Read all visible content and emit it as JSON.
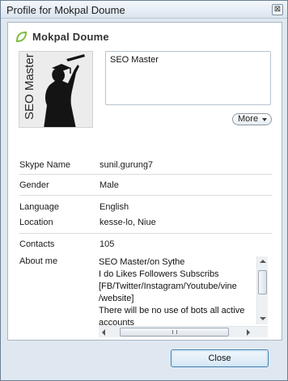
{
  "window": {
    "title": "Profile for Mokpal Doume",
    "close_glyph": "⊠"
  },
  "profile": {
    "name": "Mokpal Doume",
    "status_icon": "online-leaf-icon",
    "status_color": "#7cbc3b",
    "avatar_text": "SEO Master",
    "mood": "SEO Master",
    "more_label": "More"
  },
  "details": {
    "skype_name": {
      "label": "Skype Name",
      "value": "sunil.gurung7"
    },
    "gender": {
      "label": "Gender",
      "value": "Male"
    },
    "language": {
      "label": "Language",
      "value": "English"
    },
    "location": {
      "label": "Location",
      "value": "kesse-lo, Niue"
    },
    "contacts": {
      "label": "Contacts",
      "value": "105"
    },
    "about": {
      "label": "About me",
      "lines": [
        "SEO Master/on Sythe",
        "I do Likes Followers Subscribs",
        "[FB/Twitter/Instagram/Youtube/vine",
        "/website]",
        "There will be no use of bots all active",
        "accounts"
      ]
    }
  },
  "footer": {
    "close_label": "Close"
  }
}
